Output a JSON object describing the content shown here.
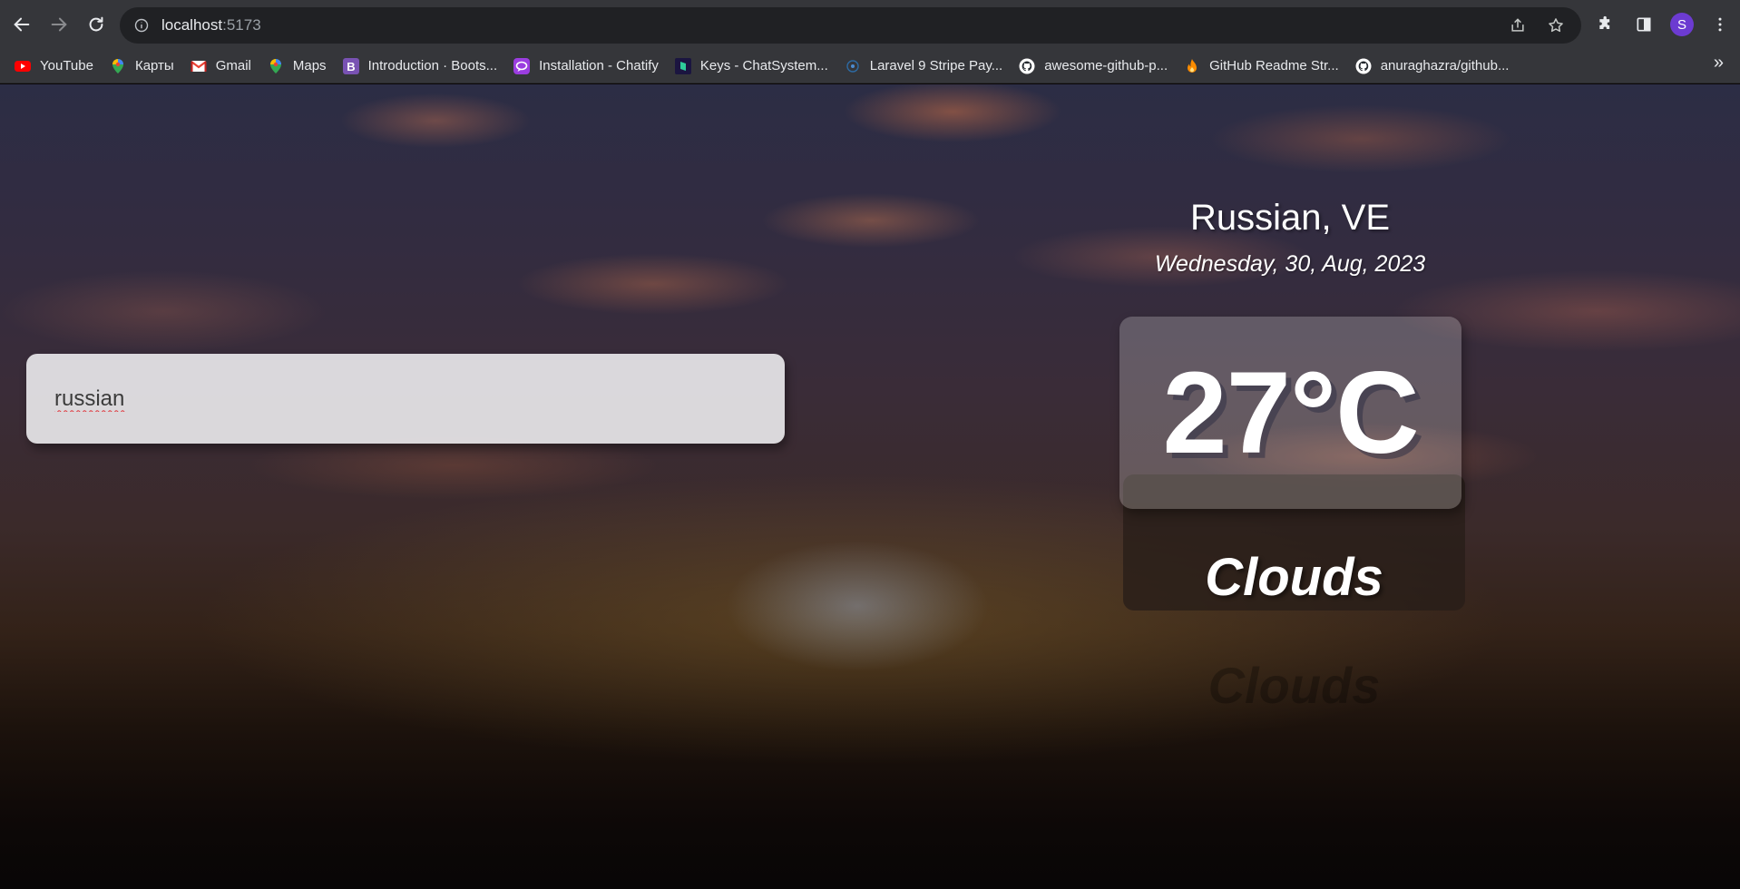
{
  "browser": {
    "url_host": "localhost",
    "url_port": ":5173",
    "profile_initial": "S",
    "bookmarks": [
      {
        "label": "YouTube",
        "icon": "youtube-icon"
      },
      {
        "label": "Карты",
        "icon": "maps-pin-icon"
      },
      {
        "label": "Gmail",
        "icon": "gmail-icon"
      },
      {
        "label": "Maps",
        "icon": "maps-pin-icon"
      },
      {
        "label": "Introduction · Boots...",
        "icon": "bootstrap-icon"
      },
      {
        "label": "Installation - Chatify",
        "icon": "chatify-icon"
      },
      {
        "label": "Keys - ChatSystem...",
        "icon": "chatsystem-icon"
      },
      {
        "label": "Laravel 9 Stripe Pay...",
        "icon": "laravel-icon"
      },
      {
        "label": "awesome-github-p...",
        "icon": "github-icon"
      },
      {
        "label": "GitHub Readme Str...",
        "icon": "fire-icon"
      },
      {
        "label": "anuraghazra/github...",
        "icon": "github-icon"
      }
    ],
    "more_label": "»"
  },
  "weather": {
    "search_value": "russian",
    "location": "Russian, VE",
    "date": "Wednesday, 30, Aug, 2023",
    "temperature": "27°C",
    "condition": "Clouds"
  },
  "colors": {
    "avatar": "#6c3bd1",
    "youtube": "#ff0000",
    "bootstrap": "#7952b3"
  }
}
